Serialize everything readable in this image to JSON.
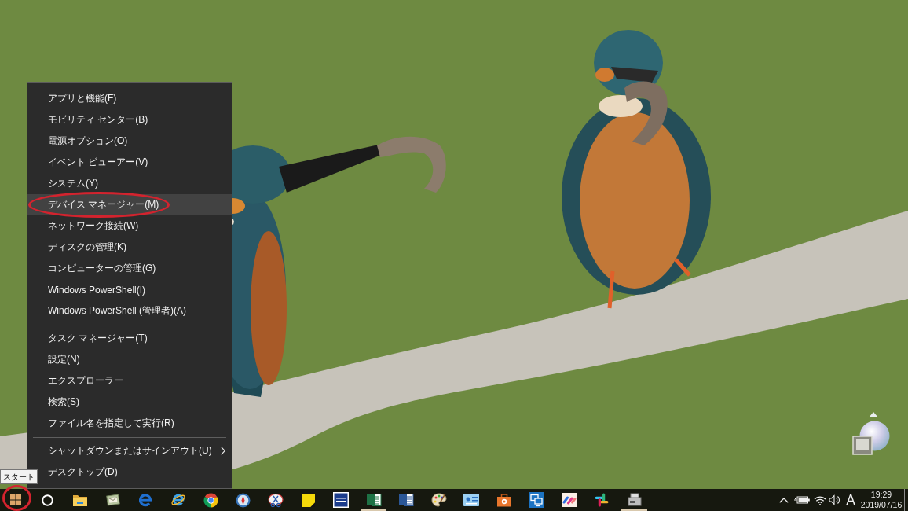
{
  "start_menu": {
    "sections": [
      {
        "items": [
          {
            "label": "アプリと機能(F)",
            "kind": "command",
            "selected": false,
            "circled": false
          },
          {
            "label": "モビリティ センター(B)",
            "kind": "command",
            "selected": false,
            "circled": false
          },
          {
            "label": "電源オプション(O)",
            "kind": "command",
            "selected": false,
            "circled": false
          },
          {
            "label": "イベント ビューアー(V)",
            "kind": "command",
            "selected": false,
            "circled": false
          },
          {
            "label": "システム(Y)",
            "kind": "command",
            "selected": false,
            "circled": false
          },
          {
            "label": "デバイス マネージャー(M)",
            "kind": "command",
            "selected": true,
            "circled": true
          },
          {
            "label": "ネットワーク接続(W)",
            "kind": "command",
            "selected": false,
            "circled": false
          },
          {
            "label": "ディスクの管理(K)",
            "kind": "command",
            "selected": false,
            "circled": false
          },
          {
            "label": "コンピューターの管理(G)",
            "kind": "command",
            "selected": false,
            "circled": false
          },
          {
            "label": "Windows PowerShell(I)",
            "kind": "command",
            "selected": false,
            "circled": false
          },
          {
            "label": "Windows PowerShell (管理者)(A)",
            "kind": "command",
            "selected": false,
            "circled": false
          }
        ]
      },
      {
        "items": [
          {
            "label": "タスク マネージャー(T)",
            "kind": "command",
            "selected": false,
            "circled": false
          },
          {
            "label": "設定(N)",
            "kind": "command",
            "selected": false,
            "circled": false
          },
          {
            "label": "エクスプローラー",
            "kind": "command",
            "selected": false,
            "circled": false
          },
          {
            "label": "検索(S)",
            "kind": "command",
            "selected": false,
            "circled": false
          },
          {
            "label": "ファイル名を指定して実行(R)",
            "kind": "command",
            "selected": false,
            "circled": false
          }
        ]
      },
      {
        "items": [
          {
            "label": "シャットダウンまたはサインアウト(U)",
            "kind": "submenu",
            "selected": false,
            "circled": false
          },
          {
            "label": "デスクトップ(D)",
            "kind": "command",
            "selected": false,
            "circled": false
          }
        ]
      }
    ]
  },
  "start_button": {
    "tooltip": "スタート",
    "circled": true
  },
  "taskbar": {
    "apps": [
      {
        "running": false
      },
      {
        "running": false
      },
      {
        "running": false
      },
      {
        "running": false
      },
      {
        "running": false
      },
      {
        "running": false
      },
      {
        "running": false
      },
      {
        "running": false
      },
      {
        "running": false
      },
      {
        "running": false
      },
      {
        "running": true
      },
      {
        "running": false
      },
      {
        "running": false
      },
      {
        "running": false
      },
      {
        "running": false
      },
      {
        "running": false
      },
      {
        "running": false
      },
      {
        "running": false
      },
      {
        "running": true
      }
    ]
  },
  "tray": {
    "ime": "A",
    "time": "19:29",
    "date": "2019/07/16"
  }
}
